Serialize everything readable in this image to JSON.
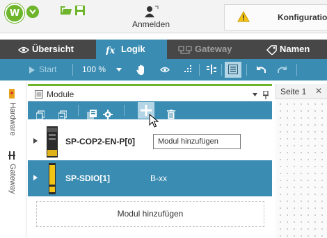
{
  "topbar": {
    "login_label": "Anmelden",
    "config_label": "Konfiguratio"
  },
  "nav": {
    "tabs": [
      {
        "label": "Übersicht",
        "active": false
      },
      {
        "label": "Logik",
        "active": true
      },
      {
        "label": "Gateway",
        "active": false,
        "disabled": true
      },
      {
        "label": "Namen",
        "active": false
      }
    ]
  },
  "toolbar": {
    "start_label": "Start",
    "zoom": "100 %"
  },
  "sidetabs": {
    "hardware_label": "Hardware",
    "gateway_label": "Gateway"
  },
  "panel": {
    "title": "Module",
    "tooltip": "Modul hinzufügen",
    "modules": [
      {
        "name": "SP-COP2-EN-P[0]",
        "type": "",
        "selected": false
      },
      {
        "name": "SP-SDIO[1]",
        "type": "B-xx",
        "selected": true
      }
    ],
    "add_module_label": "Modul hinzufügen"
  },
  "page_tabs": [
    {
      "label": "Seite 1",
      "close": "✕"
    }
  ],
  "colors": {
    "accent_blue": "#3a8cb2",
    "brand_green": "#6fb52c",
    "nav_dark": "#474747"
  }
}
